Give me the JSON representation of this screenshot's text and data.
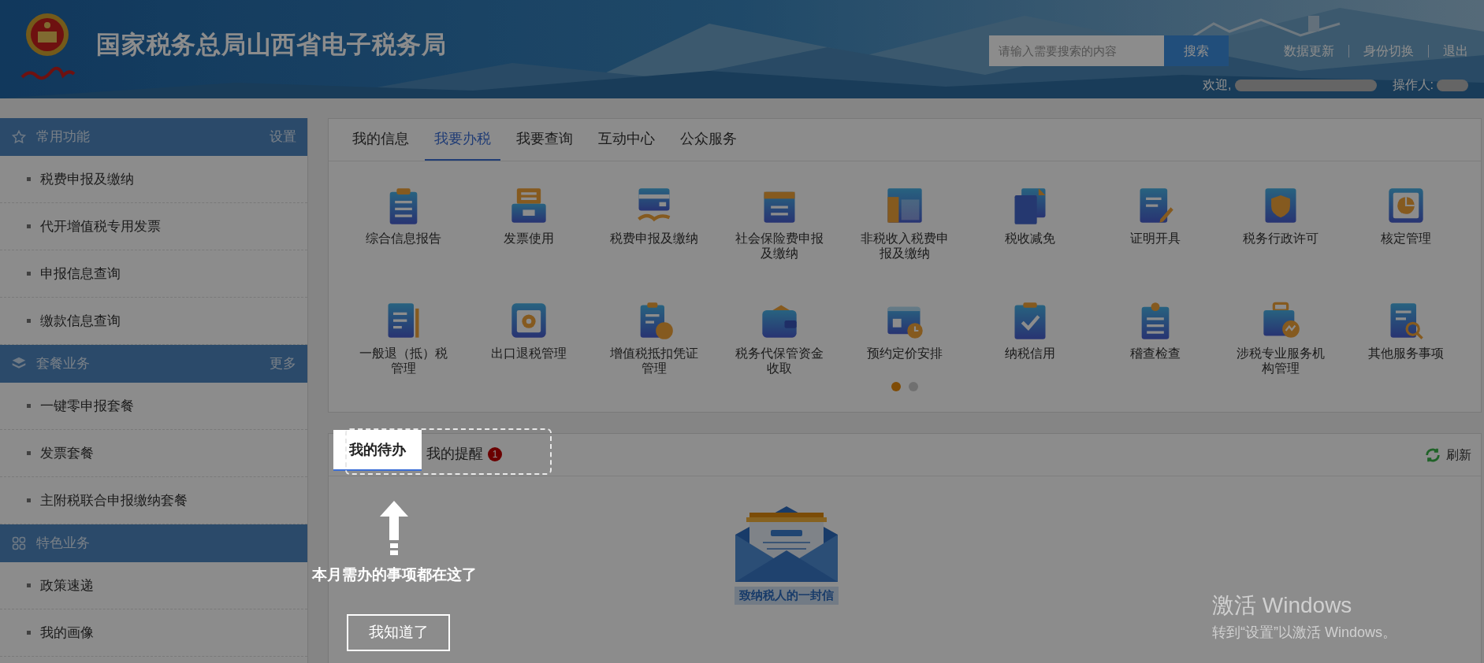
{
  "header": {
    "title": "国家税务总局山西省电子税务局",
    "search": {
      "placeholder": "请输入需要搜索的内容",
      "button": "搜索"
    },
    "links": [
      "数据更新",
      "身份切换",
      "退出"
    ],
    "welcome": "欢迎,",
    "operator": "操作人:"
  },
  "sidebar": [
    {
      "kind": "star",
      "title": "常用功能",
      "action": "设置",
      "items": [
        "税费申报及缴纳",
        "代开增值税专用发票",
        "申报信息查询",
        "缴款信息查询"
      ]
    },
    {
      "kind": "layers",
      "title": "套餐业务",
      "action": "更多",
      "items": [
        "一键零申报套餐",
        "发票套餐",
        "主附税联合申报缴纳套餐"
      ]
    },
    {
      "kind": "grid",
      "title": "特色业务",
      "items": [
        "政策速递",
        "我的画像"
      ]
    }
  ],
  "main_tabs": [
    {
      "label": "我的信息",
      "selected": false
    },
    {
      "label": "我要办税",
      "selected": true
    },
    {
      "label": "我要查询",
      "selected": false
    },
    {
      "label": "互动中心",
      "selected": false
    },
    {
      "label": "公众服务",
      "selected": false
    }
  ],
  "services": [
    "综合信息报告",
    "发票使用",
    "税费申报及缴纳",
    "社会保险费申报及缴纳",
    "非税收入税费申报及缴纳",
    "税收减免",
    "证明开具",
    "税务行政许可",
    "核定管理",
    "一般退（抵）税管理",
    "出口退税管理",
    "增值税抵扣凭证管理",
    "税务代保管资金收取",
    "预约定价安排",
    "纳税信用",
    "稽查检查",
    "涉税专业服务机构管理",
    "其他服务事项"
  ],
  "pages": [
    {
      "selected": true
    },
    {
      "selected": false
    }
  ],
  "todo_panel": {
    "tabs": [
      {
        "label": "我的待办",
        "selected": true,
        "highlighted": true
      },
      {
        "label": "我的提醒",
        "selected": false,
        "highlighted": false,
        "badge": "1"
      }
    ],
    "refresh": "刷新",
    "letter_caption": "致纳税人的一封信"
  },
  "guide": {
    "text": "本月需办的事项都在这了",
    "button": "我知道了"
  },
  "os_notice": {
    "title": "激活 Windows",
    "text": "转到“设置”以激活 Windows。"
  }
}
